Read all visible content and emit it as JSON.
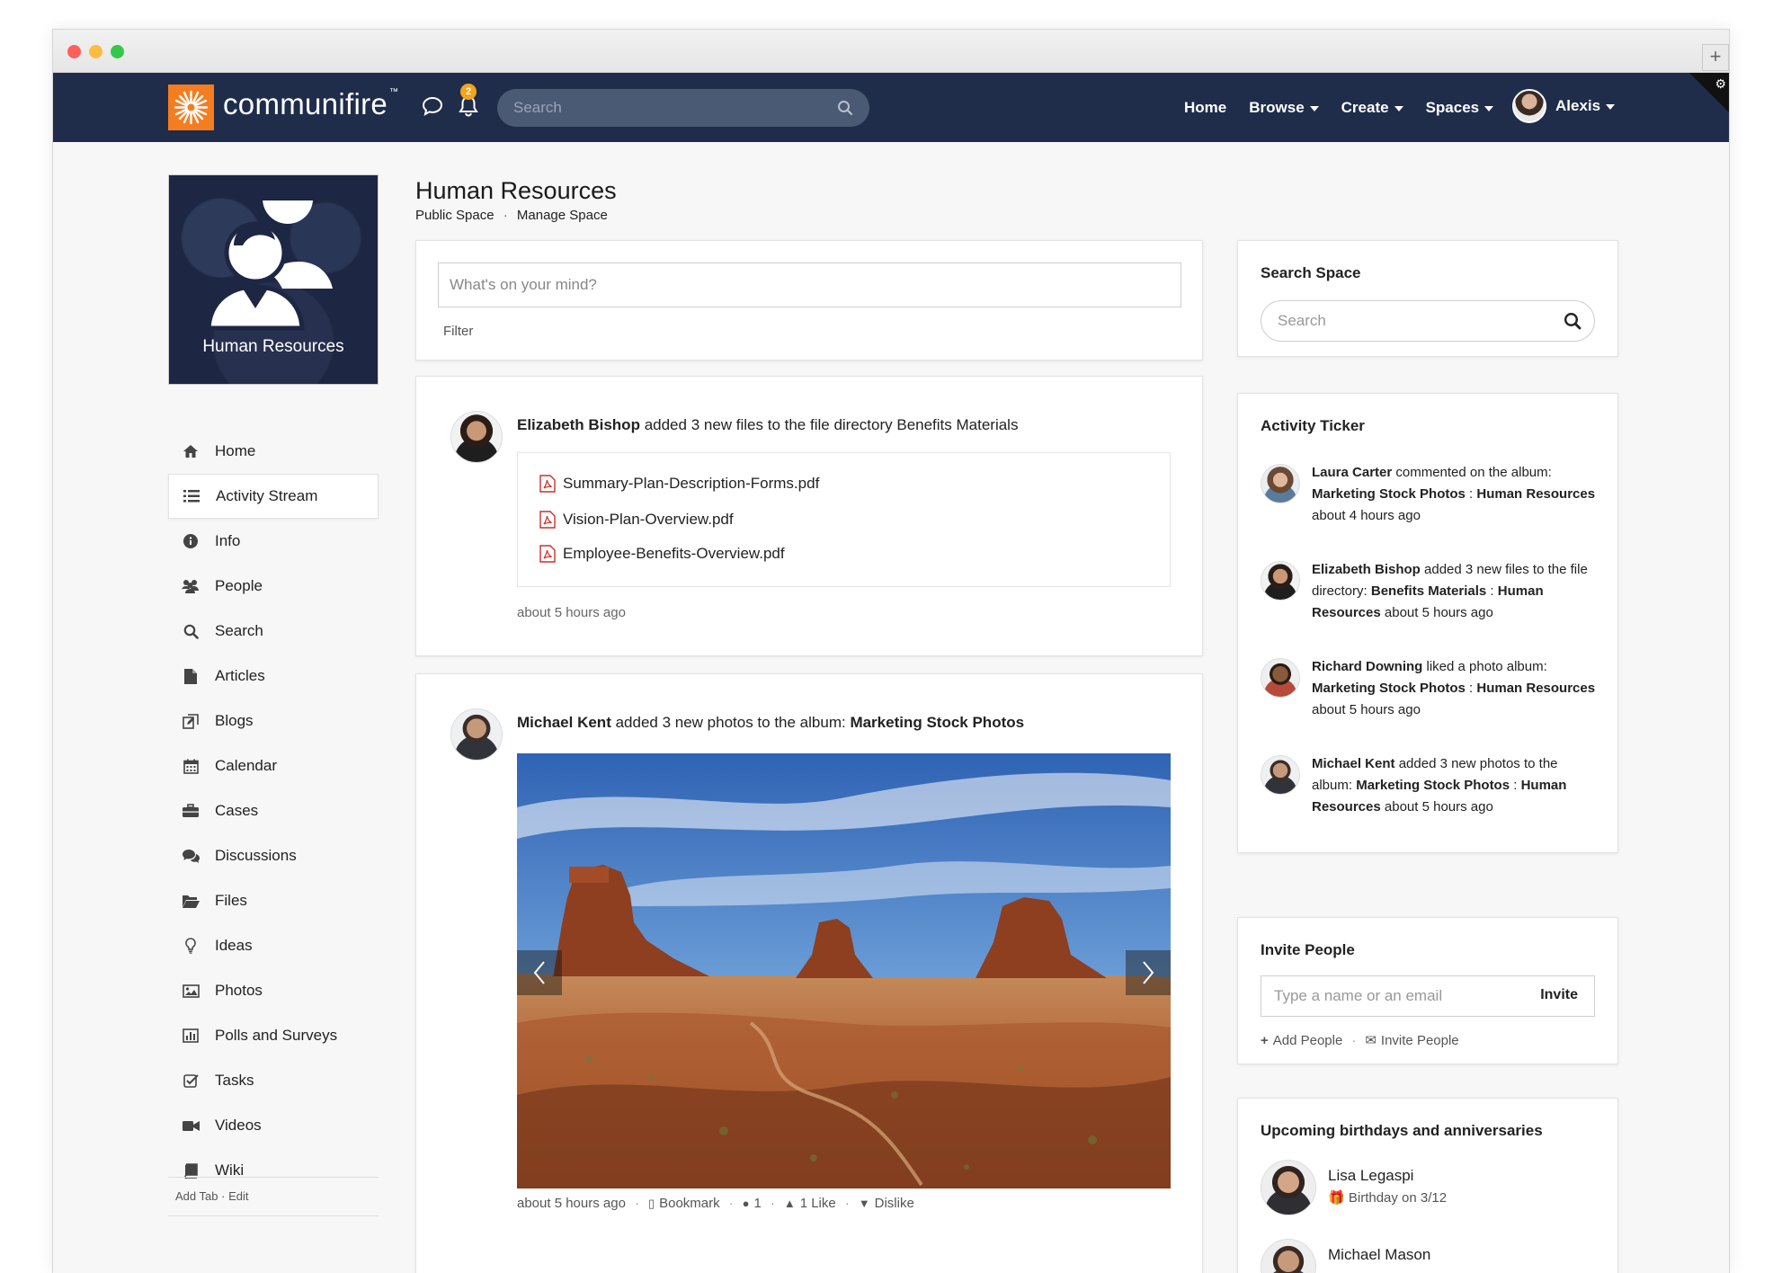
{
  "app": {
    "logo_text": "communifire",
    "logo_tm": "™",
    "notification_count": "2",
    "search_placeholder": "Search",
    "nav": [
      {
        "label": "Home",
        "caret": false
      },
      {
        "label": "Browse",
        "caret": true
      },
      {
        "label": "Create",
        "caret": true
      },
      {
        "label": "Spaces",
        "caret": true
      }
    ],
    "user_name": "Alexis"
  },
  "space": {
    "tile_label": "Human Resources",
    "title": "Human Resources",
    "subtitle_type": "Public Space",
    "subtitle_sep": "·",
    "subtitle_manage": "Manage Space"
  },
  "sidebar": {
    "items": [
      {
        "label": "Home",
        "icon": "home-icon"
      },
      {
        "label": "Activity Stream",
        "icon": "list-icon"
      },
      {
        "label": "Info",
        "icon": "info-icon"
      },
      {
        "label": "People",
        "icon": "people-icon"
      },
      {
        "label": "Search",
        "icon": "search-icon"
      },
      {
        "label": "Articles",
        "icon": "file-icon"
      },
      {
        "label": "Blogs",
        "icon": "blog-icon"
      },
      {
        "label": "Calendar",
        "icon": "calendar-icon"
      },
      {
        "label": "Cases",
        "icon": "briefcase-icon"
      },
      {
        "label": "Discussions",
        "icon": "comments-icon"
      },
      {
        "label": "Files",
        "icon": "folder-icon"
      },
      {
        "label": "Ideas",
        "icon": "lightbulb-icon"
      },
      {
        "label": "Photos",
        "icon": "image-icon"
      },
      {
        "label": "Polls and Surveys",
        "icon": "bar-chart-icon"
      },
      {
        "label": "Tasks",
        "icon": "checkbox-icon"
      },
      {
        "label": "Videos",
        "icon": "video-icon"
      },
      {
        "label": "Wiki",
        "icon": "book-icon"
      }
    ],
    "active_index": 1,
    "footer_add": "Add Tab",
    "footer_sep": "·",
    "footer_edit": "Edit"
  },
  "composer": {
    "placeholder": "What's on your mind?",
    "filter_label": "Filter"
  },
  "posts": [
    {
      "author": "Elizabeth Bishop",
      "action": " added 3 new files to the file directory Benefits Materials",
      "files": [
        "Summary-Plan-Description-Forms.pdf",
        "Vision-Plan-Overview.pdf",
        "Employee-Benefits-Overview.pdf"
      ],
      "time": "about 5 hours ago"
    },
    {
      "author": "Michael Kent",
      "action": " added 3 new photos to the album: ",
      "album": "Marketing Stock Photos",
      "time": "about 5 hours ago",
      "bookmark_label": "Bookmark",
      "comment_count": "1",
      "like_label": "1 Like",
      "dislike_label": "Dislike",
      "sep": "·"
    }
  ],
  "search_space": {
    "title": "Search Space",
    "placeholder": "Search"
  },
  "ticker": {
    "title": "Activity Ticker",
    "items": [
      {
        "name": "Laura Carter",
        "action": " commented on the album: ",
        "target": "Marketing Stock Photos",
        "sep": " : ",
        "space": "Human Resources",
        "time": " about 4 hours ago"
      },
      {
        "name": "Elizabeth Bishop",
        "action": " added 3 new files to the file directory: ",
        "target": "Benefits Materials",
        "sep": " : ",
        "space": "Human Resources",
        "time": " about 5 hours ago"
      },
      {
        "name": "Richard Downing",
        "action": " liked a photo album: ",
        "target": "Marketing Stock Photos",
        "sep": " : ",
        "space": "Human Resources",
        "time": " about 5 hours ago"
      },
      {
        "name": "Michael Kent",
        "action": " added 3 new photos to the album: ",
        "target": "Marketing Stock Photos",
        "sep": " : ",
        "space": "Human Resources",
        "time": " about 5 hours ago"
      }
    ]
  },
  "invite": {
    "title": "Invite People",
    "placeholder": "Type a name or an email",
    "button": "Invite",
    "add_people": "Add People",
    "sep": "·",
    "invite_people": "Invite People"
  },
  "birthdays": {
    "title": "Upcoming birthdays and anniversaries",
    "items": [
      {
        "name": "Lisa Legaspi",
        "detail": "Birthday on 3/12"
      },
      {
        "name": "Michael Mason",
        "detail": ""
      }
    ]
  },
  "colors": {
    "navbar": "#1f2d4b",
    "brand_orange": "#f47d20",
    "badge": "#f4a31d"
  }
}
